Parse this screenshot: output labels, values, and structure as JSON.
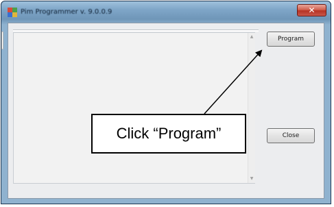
{
  "window": {
    "title": "Pim Programmer v. 9.0.0.9",
    "close_glyph": "✕"
  },
  "buttons": {
    "program_label": "Program",
    "close_label": "Close"
  },
  "annotation": {
    "callout_text": "Click “Program”"
  },
  "icons": {
    "app": "app-logo-icon",
    "close": "close-icon",
    "scroll_up": "scroll-up-arrow-icon",
    "scroll_down": "scroll-down-arrow-icon"
  },
  "colors": {
    "titlebar": "#7fa6c8",
    "close_button": "#c9473a",
    "client_bg": "#ecedef"
  }
}
